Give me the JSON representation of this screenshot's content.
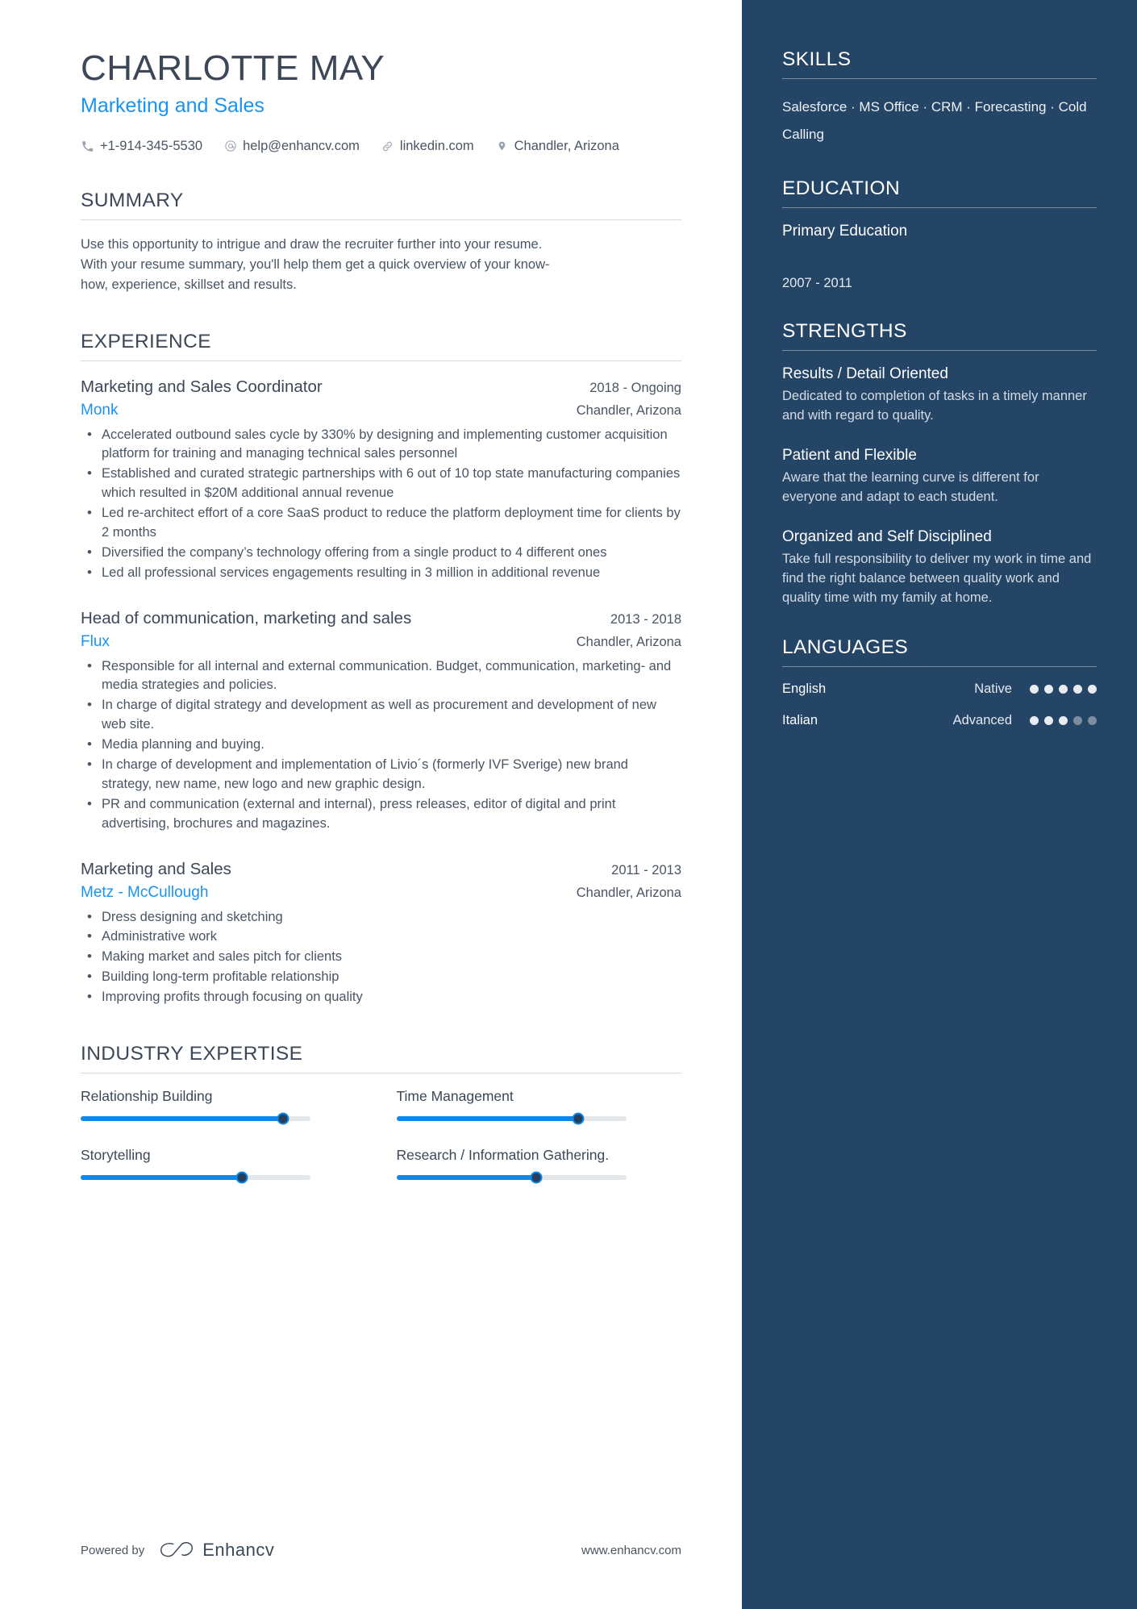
{
  "header": {
    "name": "CHARLOTTE MAY",
    "headline": "Marketing and Sales",
    "contacts": [
      {
        "icon": "phone-icon",
        "value": "+1-914-345-5530"
      },
      {
        "icon": "email-icon",
        "value": "help@enhancv.com"
      },
      {
        "icon": "link-icon",
        "value": "linkedin.com"
      },
      {
        "icon": "location-pin-icon",
        "value": "Chandler, Arizona"
      }
    ]
  },
  "summary": {
    "title": "SUMMARY",
    "text": "Use this opportunity to intrigue and draw the recruiter further into your resume. With your resume summary, you'll help them get a quick overview of your know-how, experience, skillset and results."
  },
  "experience": {
    "title": "EXPERIENCE",
    "jobs": [
      {
        "title": "Marketing and Sales Coordinator",
        "dates": "2018 - Ongoing",
        "company": "Monk",
        "location": "Chandler, Arizona",
        "bullets": [
          "Accelerated outbound sales cycle by 330% by designing and implementing customer acquisition platform for training and managing technical sales personnel",
          "Established and curated strategic partnerships with 6 out of 10 top state manufacturing companies which resulted in $20M additional annual revenue",
          "Led re-architect effort of a core SaaS product to reduce the platform deployment time for clients by 2 months",
          "Diversified the company’s technology offering from a single product to 4 different ones",
          "Led all professional services engagements resulting in 3 million in additional revenue"
        ]
      },
      {
        "title": "Head of communication, marketing and sales",
        "dates": "2013 - 2018",
        "company": "Flux",
        "location": "Chandler, Arizona",
        "bullets": [
          "Responsible for all internal and external communication. Budget, communication, marketing- and media strategies and policies.",
          "In charge of digital strategy and development as well as procurement and development of new web site.",
          "Media planning and buying.",
          "In charge of development and implementation of Livio´s (formerly IVF Sverige) new brand strategy, new name, new logo and new graphic design.",
          "PR and communication (external and internal), press releases, editor of digital and print advertising, brochures and magazines."
        ]
      },
      {
        "title": "Marketing and Sales",
        "dates": "2011 - 2013",
        "company": "Metz - McCullough",
        "location": "Chandler, Arizona",
        "bullets": [
          "Dress designing and sketching",
          "Administrative work",
          "Making market and sales pitch for clients",
          "Building long-term profitable relationship",
          "Improving profits through focusing on quality"
        ]
      }
    ]
  },
  "industry_expertise": {
    "title": "INDUSTRY EXPERTISE",
    "items": [
      {
        "label": "Relationship Building",
        "value": 88
      },
      {
        "label": "Time Management",
        "value": 79
      },
      {
        "label": "Storytelling",
        "value": 70
      },
      {
        "label": "Research / Information Gathering.",
        "value": 61
      }
    ]
  },
  "sidebar": {
    "skills": {
      "title": "SKILLS",
      "text": "Salesforce · MS Office · CRM · Forecasting · Cold Calling"
    },
    "education": {
      "title": "EDUCATION",
      "degree": "Primary Education",
      "dates": "2007 - 2011"
    },
    "strengths": {
      "title": "STRENGTHS",
      "items": [
        {
          "title": "Results / Detail Oriented",
          "desc": "Dedicated to completion of tasks in a timely manner and with regard to quality."
        },
        {
          "title": "Patient and Flexible",
          "desc": "Aware that the learning curve is different for everyone and adapt to each student."
        },
        {
          "title": "Organized and Self Disciplined",
          "desc": "Take full responsibility to deliver my work in time and find the right balance between quality work and quality time with my family at home."
        }
      ]
    },
    "languages": {
      "title": "LANGUAGES",
      "items": [
        {
          "name": "English",
          "level": "Native",
          "filled": 5,
          "total": 5
        },
        {
          "name": "Italian",
          "level": "Advanced",
          "filled": 3,
          "total": 5
        }
      ]
    }
  },
  "footer": {
    "powered_by": "Powered by",
    "brand": "Enhancv",
    "website": "www.enhancv.com"
  },
  "colors": {
    "accent_blue": "#1a93f0",
    "sidebar_bg": "#254567",
    "text_dark": "#3c4858",
    "text_body": "#4a5563"
  }
}
